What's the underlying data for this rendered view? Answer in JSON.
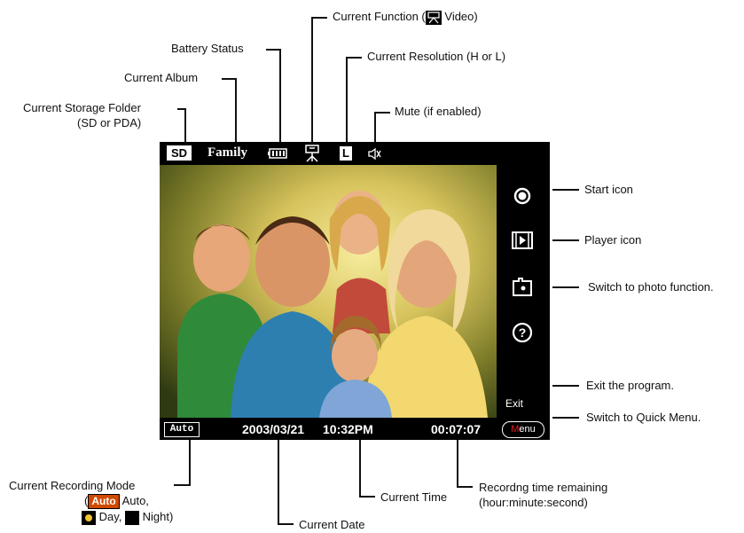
{
  "screen": {
    "storage": "SD",
    "album": "Family",
    "resolution": "L",
    "recording_mode": "Auto",
    "date": "2003/03/21",
    "time": "10:32PM",
    "remaining": "00:07:07",
    "exit_label": "Exit",
    "menu_label_first": "M",
    "menu_label_rest": "enu"
  },
  "callouts": {
    "storage_folder_1": "Current Storage Folder",
    "storage_folder_2": "(SD or PDA)",
    "album": "Current Album",
    "battery": "Battery Status",
    "function_prefix": "Current Function (",
    "function_suffix": " Video)",
    "resolution": "Current Resolution (H or L)",
    "mute": "Mute (if enabled)",
    "start": "Start icon",
    "player": "Player icon",
    "photo": "Switch to photo function.",
    "exit": "Exit the program.",
    "quick_menu": "Switch to Quick Menu.",
    "rec_mode_1": "Current Recording Mode",
    "rec_mode_open": "(",
    "rec_mode_auto_chip": "Auto",
    "rec_mode_auto": " Auto,",
    "rec_mode_day": " Day,",
    "rec_mode_night": " Night)",
    "date": "Current Date",
    "time": "Current Time",
    "remaining_1": "Recordng time remaining",
    "remaining_2": "(hour:minute:second)"
  },
  "icons": [
    "battery-icon",
    "video-camera-icon",
    "mute-icon",
    "start-record-icon",
    "player-icon",
    "photo-camera-icon",
    "help-icon"
  ]
}
